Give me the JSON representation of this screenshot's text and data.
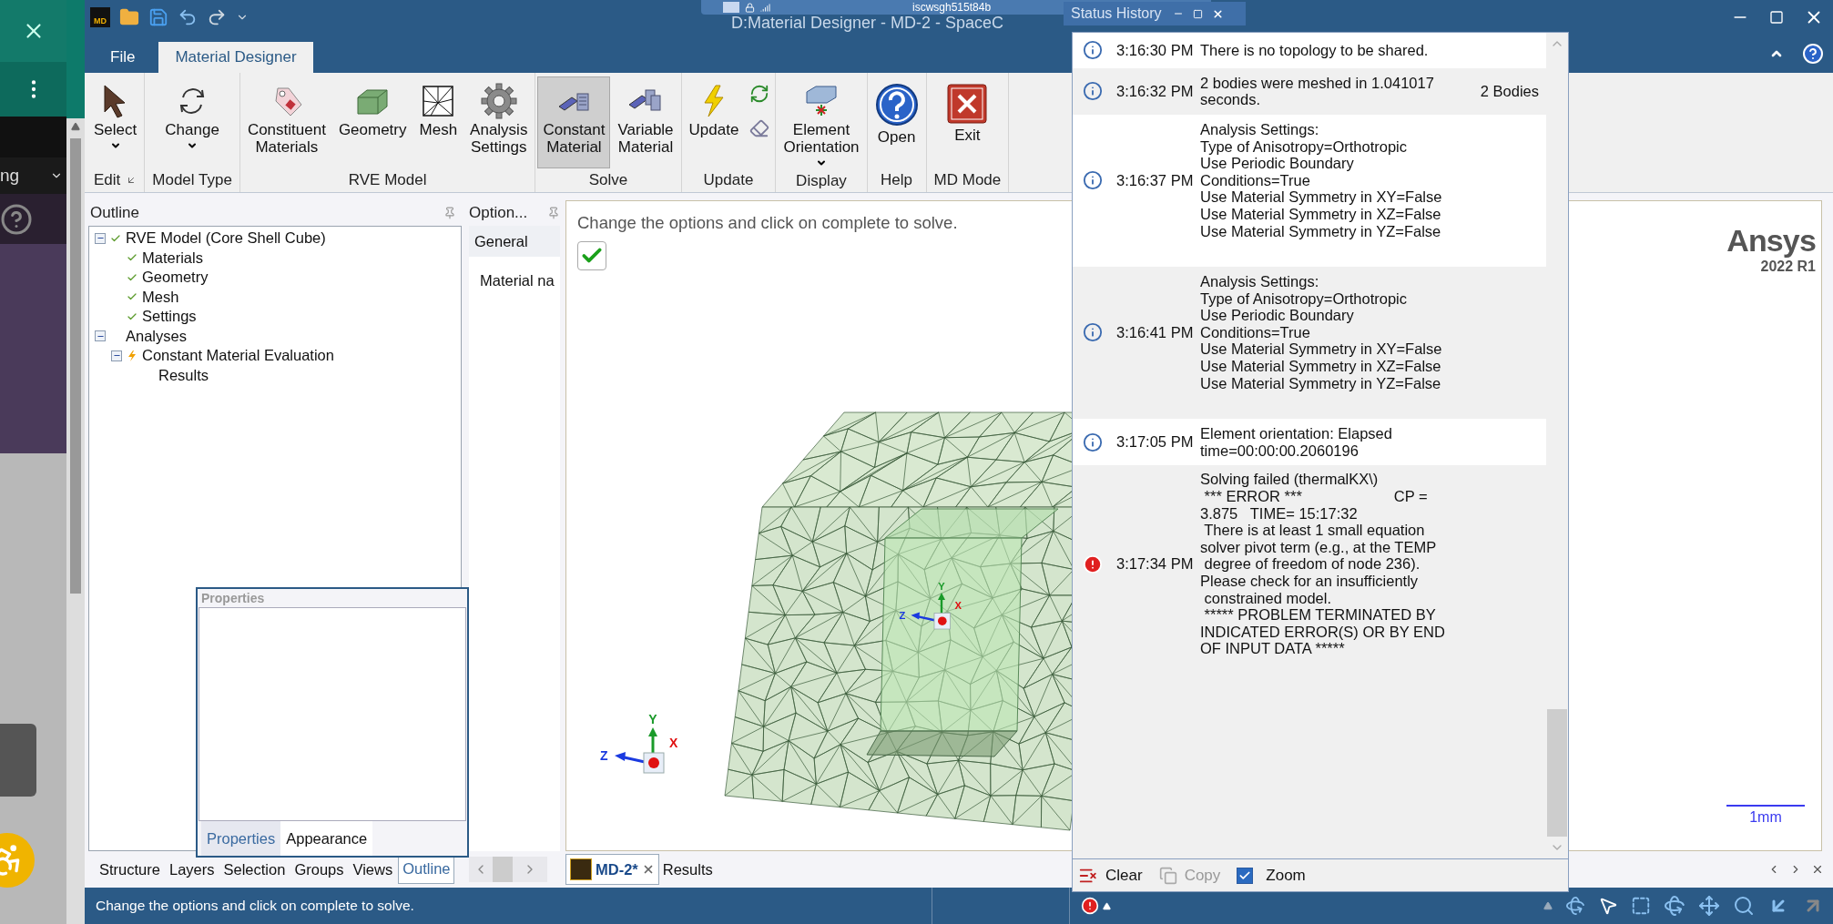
{
  "side_strip": {
    "text": "ng"
  },
  "window": {
    "app_logo": "MD",
    "title": "D:Material Designer - MD-2 - SpaceC",
    "remote_host": "iscwsgh515t84b"
  },
  "menu_tabs": [
    {
      "label": "File",
      "selected": false
    },
    {
      "label": "Material Designer",
      "selected": true
    }
  ],
  "ribbon": [
    {
      "label": "Edit",
      "launcher": true,
      "buttons": [
        {
          "label": "Select",
          "kind": "pointer",
          "dropdown": true,
          "selected": false
        }
      ]
    },
    {
      "label": "Model Type",
      "buttons": [
        {
          "label": "Change",
          "kind": "rotate",
          "dropdown": true,
          "selected": false
        }
      ]
    },
    {
      "label": "RVE Model",
      "buttons": [
        {
          "label": "Constituent\nMaterials",
          "kind": "tag",
          "selected": false
        },
        {
          "label": "Geometry",
          "kind": "box",
          "selected": false
        },
        {
          "label": "Mesh",
          "kind": "mesh",
          "selected": false
        },
        {
          "label": "Analysis\nSettings",
          "kind": "gear",
          "selected": false
        }
      ]
    },
    {
      "label": "Solve",
      "buttons": [
        {
          "label": "Constant\nMaterial",
          "kind": "book",
          "selected": true
        },
        {
          "label": "Variable\nMaterial",
          "kind": "books",
          "selected": false
        }
      ]
    },
    {
      "label": "Update",
      "buttons": [
        {
          "label": "Update",
          "kind": "bolt",
          "selected": false
        },
        {
          "kind": "small_tools"
        }
      ]
    },
    {
      "label": "Display",
      "buttons": [
        {
          "label": "Element\nOrientation",
          "kind": "orientation",
          "dropdown": true,
          "selected": false
        }
      ]
    },
    {
      "label": "Help",
      "buttons": [
        {
          "label": "Open",
          "kind": "help",
          "selected": false
        }
      ]
    },
    {
      "label": "MD Mode",
      "buttons": [
        {
          "label": "Exit",
          "kind": "exit",
          "selected": false
        }
      ]
    }
  ],
  "outline": {
    "title": "Outline",
    "tree": [
      {
        "label": "RVE Model (Core Shell Cube)",
        "kind": "check",
        "expanded": true,
        "children": [
          {
            "label": "Materials",
            "kind": "check"
          },
          {
            "label": "Geometry",
            "kind": "check"
          },
          {
            "label": "Mesh",
            "kind": "check"
          },
          {
            "label": "Settings",
            "kind": "check"
          }
        ]
      },
      {
        "label": "Analyses",
        "expanded": true,
        "children": [
          {
            "label": "Constant Material Evaluation",
            "kind": "bolt",
            "expanded": true,
            "children": [
              {
                "label": "Results"
              }
            ]
          }
        ]
      }
    ]
  },
  "options": {
    "title": "Option...",
    "section": "General",
    "field_label": "Material na"
  },
  "properties": {
    "title": "Properties",
    "tabs": [
      {
        "label": "Properties",
        "selected": true
      },
      {
        "label": "Appearance",
        "selected": false
      }
    ]
  },
  "panel_tabs": [
    {
      "label": "Structure",
      "selected": false
    },
    {
      "label": "Layers",
      "selected": false
    },
    {
      "label": "Selection",
      "selected": false
    },
    {
      "label": "Groups",
      "selected": false
    },
    {
      "label": "Views",
      "selected": false
    },
    {
      "label": "Outline",
      "selected": true
    }
  ],
  "viewport": {
    "instruction": "Change the options and click on complete to solve.",
    "logo": "Ansys",
    "version": "2022 R1",
    "scale": "1mm",
    "triad_labels": {
      "x": "X",
      "y": "Y",
      "z": "Z"
    },
    "model_triad_labels": {
      "x": "X",
      "y": "Y",
      "z": "Z"
    }
  },
  "doc_tabs": [
    {
      "label": "MD-2*",
      "selected": true,
      "closable": true
    },
    {
      "label": "Results",
      "selected": false,
      "closable": false
    }
  ],
  "status_history": {
    "title": "Status History",
    "entries": [
      {
        "kind": "info",
        "time": "3:16:30 PM",
        "message": "There is no topology to be shared."
      },
      {
        "kind": "info",
        "time": "3:16:32 PM",
        "message": "2 bodies were meshed in 1.041017\nseconds.",
        "detail": "2 Bodies"
      },
      {
        "kind": "info",
        "time": "3:16:37 PM",
        "message": "Analysis Settings:\nType of Anisotropy=Orthotropic\nUse Periodic Boundary\nConditions=True\nUse Material Symmetry in XY=False\nUse Material Symmetry in XZ=False\nUse Material Symmetry in YZ=False"
      },
      {
        "kind": "info",
        "time": "3:16:41 PM",
        "message": "Analysis Settings:\nType of Anisotropy=Orthotropic\nUse Periodic Boundary\nConditions=True\nUse Material Symmetry in XY=False\nUse Material Symmetry in XZ=False\nUse Material Symmetry in YZ=False"
      },
      {
        "kind": "info",
        "time": "3:17:05 PM",
        "message": "Element orientation: Elapsed\ntime=00:00:00.2060196"
      },
      {
        "kind": "error",
        "time": "3:17:34 PM",
        "message": "Solving failed (thermalKX\\)\n *** ERROR ***                      CP =\n3.875   TIME= 15:17:32\n There is at least 1 small equation\nsolver pivot term (e.g., at the TEMP\n degree of freedom of node 236).\nPlease check for an insufficiently\n constrained model.\n ***** PROBLEM TERMINATED BY\nINDICATED ERROR(S) OR BY END\nOF INPUT DATA *****"
      }
    ],
    "clear": {
      "label": "Clear",
      "disabled": false
    },
    "copy": {
      "label": "Copy",
      "disabled": true
    },
    "zoom": {
      "label": "Zoom",
      "checked": true
    }
  },
  "status_bar": {
    "message": "Change the options and click on complete to solve."
  }
}
